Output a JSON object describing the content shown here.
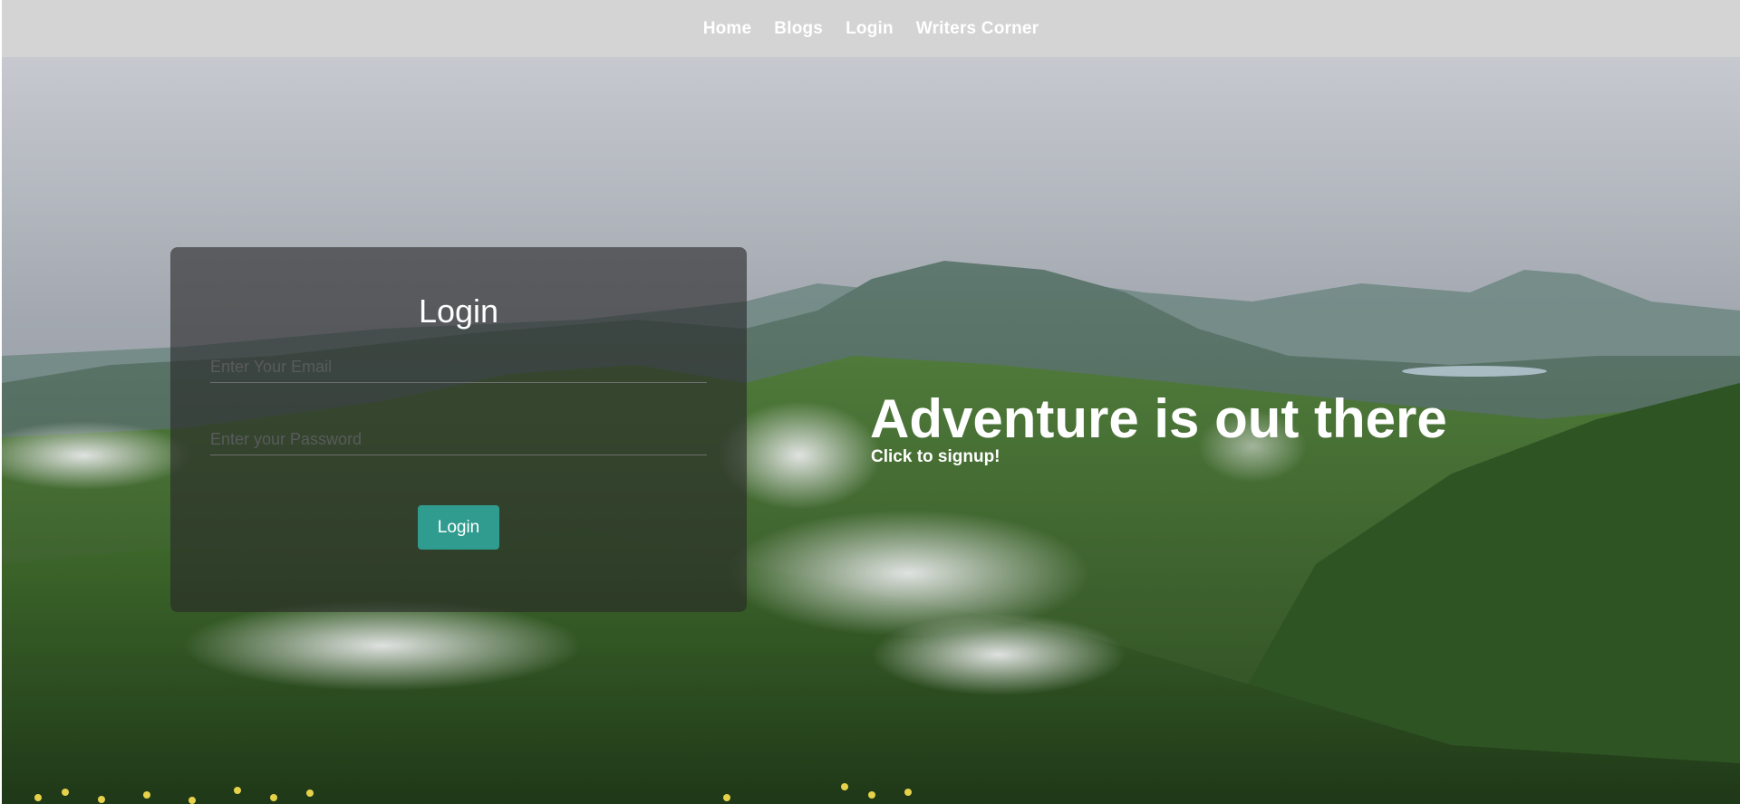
{
  "nav": {
    "links": [
      "Home",
      "Blogs",
      "Login",
      "Writers Corner"
    ]
  },
  "login": {
    "title": "Login",
    "email_placeholder": "Enter Your Email",
    "password_placeholder": "Enter your Password",
    "button_label": "Login"
  },
  "hero": {
    "heading": "Adventure is out there",
    "subtext": "Click to signup!"
  },
  "colors": {
    "navbar_bg": "#d4d4d4",
    "button_bg": "#2f9c8f",
    "card_bg": "rgba(40,40,40,0.62)"
  }
}
